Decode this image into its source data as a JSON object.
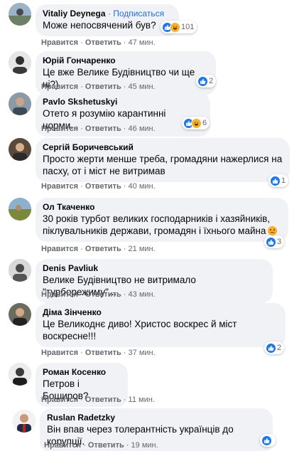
{
  "colors": {
    "bubble": "#f0f2f5",
    "link": "#216fdb",
    "meta": "#65676b",
    "like": "#1877f2",
    "haha": "#f7b125"
  },
  "labels": {
    "like": "Нравится",
    "reply": "Ответить",
    "separator": "·"
  },
  "comments": [
    {
      "author": "Vitaliy Deynega",
      "follow": "Подписаться",
      "text": "Може непосвячений був?",
      "time": "47 мин.",
      "reactions": [
        "like-icon",
        "haha-icon"
      ],
      "reaction_count": "101"
    },
    {
      "author": "Юрій Гончаренко",
      "text": "Це вже Велике Будівництво чи ще ні?)",
      "time": "45 мин.",
      "reactions": [
        "like-icon"
      ],
      "reaction_count": "2"
    },
    {
      "author": "Pavlo Skshetuskyi",
      "text": "Отето я розумію карантинні норми...",
      "time": "46 мин.",
      "reactions": [
        "like-icon",
        "haha-icon"
      ],
      "reaction_count": "6"
    },
    {
      "author": "Сергій Боричевський",
      "text_lines": [
        "Просто жерти менше треба, громадяни нажерлися на",
        "пасху, от і міст не витримав"
      ],
      "time": "40 мин.",
      "reactions": [
        "like-icon"
      ],
      "reaction_count": "1"
    },
    {
      "author": "Ол Ткаченко",
      "text_lines": [
        "30 років турбот великих господарників і хазяйників,",
        "піклувальників держави, громадян і їхнього майна"
      ],
      "time": "21 мин.",
      "reactions": [
        "like-icon"
      ],
      "reaction_count": "3"
    },
    {
      "author": "Denis Pavliuk",
      "text": "Велике Будівництво не витримало \"турборежиму\"...",
      "time": "43 мин."
    },
    {
      "author": "Діма Зінченко",
      "text_lines": [
        "Це Великоднє диво! Христос воскрес й міст",
        "воскресне!!!"
      ],
      "time": "37 мин.",
      "reactions": [
        "like-icon"
      ],
      "reaction_count": "2"
    },
    {
      "author": "Роман Косенко",
      "text": "Петров і Боширов?",
      "time": "11 мин."
    },
    {
      "author": "Ruslan Radetzky",
      "text": "Він впав через толерантність українців до корупції.",
      "time": "19 мин.",
      "reactions": [
        "like-icon"
      ],
      "reaction_count": ""
    }
  ]
}
